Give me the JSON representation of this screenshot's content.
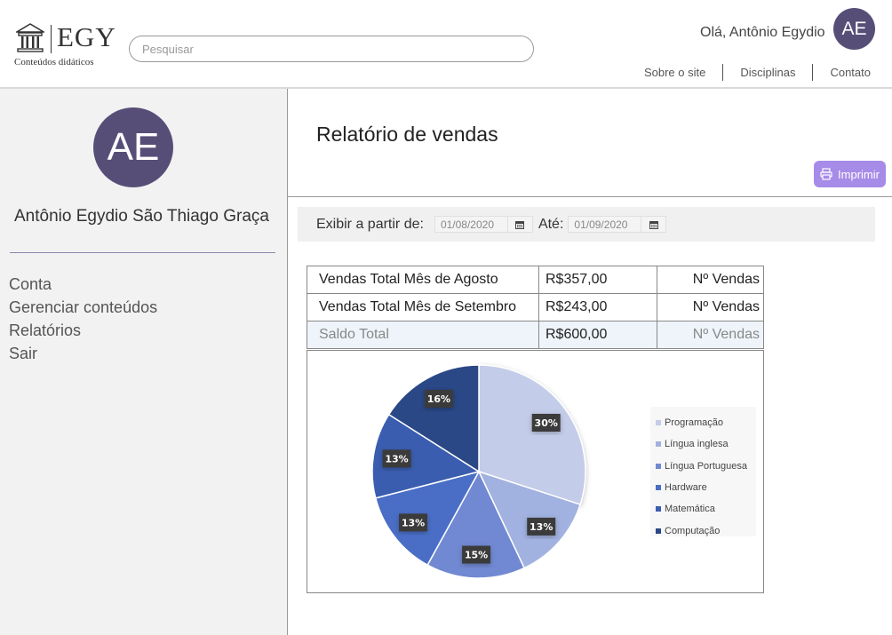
{
  "header": {
    "logo_text": "EGY",
    "logo_subtitle": "Conteúdos didáticos",
    "logo_icon": "museum-building-icon",
    "search_placeholder": "Pesquisar",
    "greeting": "Olá, Antônio Egydio",
    "avatar_initials": "AE",
    "nav": [
      "Sobre o site",
      "Disciplinas",
      "Contato"
    ]
  },
  "sidebar": {
    "avatar_initials": "AE",
    "user_name": "Antônio Egydio São Thiago Graça",
    "menu": [
      "Conta",
      "Gerenciar conteúdos",
      "Relatórios",
      "Sair"
    ]
  },
  "main": {
    "title": "Relatório de vendas",
    "print_label": "Imprimir",
    "print_icon": "printer-icon",
    "filter": {
      "from_label": "Exibir a partir de:",
      "from_date": "01/08/2020",
      "to_label": "Até:",
      "to_date": "01/09/2020",
      "calendar_icon": "calendar-icon"
    },
    "table": {
      "rows": [
        {
          "label": "Vendas Total Mês de Agosto",
          "value": "R$357,00",
          "count": "Nº Vendas"
        },
        {
          "label": "Vendas Total Mês de Setembro",
          "value": "R$243,00",
          "count": "Nº Vendas"
        },
        {
          "label": "Saldo Total",
          "value": "R$600,00",
          "count": "Nº Vendas"
        }
      ]
    }
  },
  "chart_data": {
    "type": "pie",
    "categories": [
      "Programação",
      "Língua inglesa",
      "Língua Portuguesa",
      "Hardware",
      "Matemática",
      "Computação"
    ],
    "values": [
      30,
      13,
      15,
      13,
      13,
      16
    ],
    "labels": [
      "30%",
      "13%",
      "15%",
      "13%",
      "13%",
      "16%"
    ],
    "colors": [
      "#c3cce8",
      "#a1b1e0",
      "#7189d2",
      "#4a6ec6",
      "#3a5daf",
      "#2a4886"
    ],
    "legend_position": "right"
  },
  "colors": {
    "avatar": "#574e78",
    "accent": "#a78be8",
    "sidebar_bg": "#f2f2f2"
  }
}
